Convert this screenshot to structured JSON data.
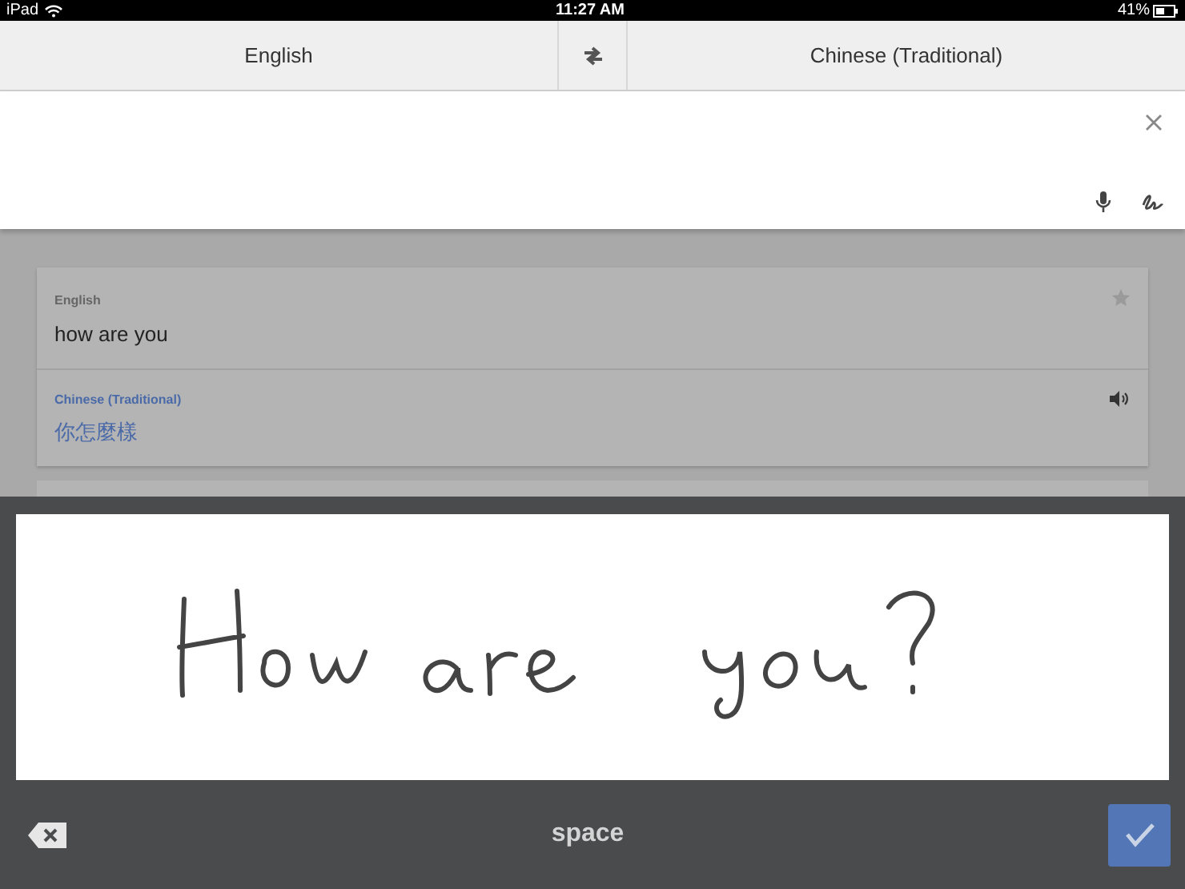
{
  "status_bar": {
    "device": "iPad",
    "time": "11:27 AM",
    "battery": "41%"
  },
  "language_bar": {
    "source": "English",
    "target": "Chinese (Traditional)"
  },
  "result_card": {
    "source_label": "English",
    "source_text": "how are you",
    "target_label": "Chinese (Traditional)",
    "target_text": "你怎麼樣"
  },
  "handwriting_panel": {
    "space_key": "space"
  }
}
